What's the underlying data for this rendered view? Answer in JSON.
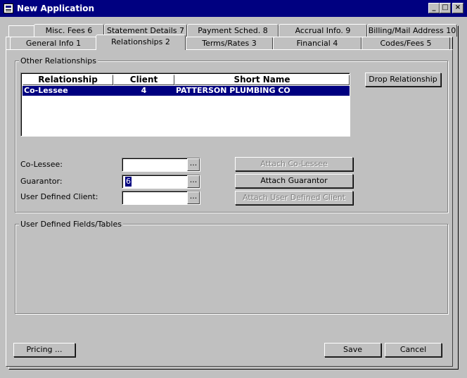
{
  "window": {
    "title": "New Application",
    "minimize": "_",
    "maximize": "□",
    "close": "×"
  },
  "tabs_back": [
    "Misc. Fees 6",
    "Statement Details 7",
    "Payment Sched. 8",
    "Accrual Info. 9",
    "Billing/Mail Address 10"
  ],
  "tabs_front": [
    "General Info 1",
    "Relationships 2",
    "Terms/Rates 3",
    "Financial 4",
    "Codes/Fees 5"
  ],
  "active_tab": "Relationships 2",
  "other_relationships": {
    "label": "Other Relationships",
    "columns": [
      "Relationship",
      "Client",
      "Short Name"
    ],
    "rows": [
      {
        "relationship": "Co-Lessee",
        "client": "4",
        "short_name": "PATTERSON PLUMBING CO"
      }
    ],
    "drop_button": "Drop Relationship"
  },
  "fields": {
    "colessee": {
      "label": "Co-Lessee:",
      "value": ""
    },
    "guarantor": {
      "label": "Guarantor:",
      "value": "6"
    },
    "user_defined_client": {
      "label": "User Defined Client:",
      "value": ""
    },
    "browse": "..."
  },
  "attach_buttons": {
    "colessee": "Attach Co-Lessee",
    "guarantor": "Attach Guarantor",
    "user_defined": "Attach User Defined Client"
  },
  "user_defined_section": {
    "label": "User Defined Fields/Tables"
  },
  "footer": {
    "pricing": "Pricing ...",
    "save": "Save",
    "cancel": "Cancel"
  }
}
